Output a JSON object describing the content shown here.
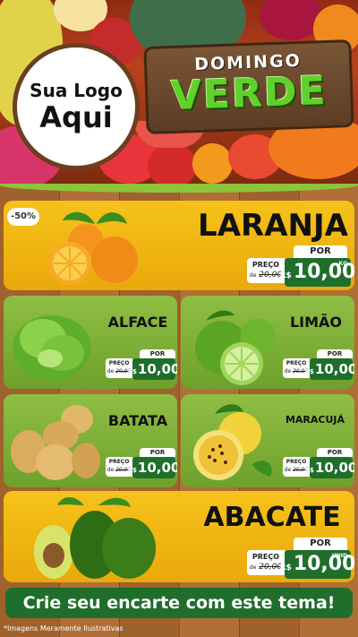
{
  "header": {
    "logo_line1": "Sua Logo",
    "logo_line2": "Aqui",
    "title_top": "DOMINGO",
    "title_bottom": "VERDE"
  },
  "colors": {
    "yellow_card": "#f6c21a",
    "green_card": "#8fbe43",
    "price_green": "#1f6e2c",
    "title_green": "#5fd12b",
    "wood": "#a0622d"
  },
  "discount_badge": "-50%",
  "products": [
    {
      "name": "LARANJA",
      "por": "POR",
      "preco_label": "PREÇO",
      "old_price": "20,00",
      "old_prefix": "de",
      "currency": "R$",
      "price": "10,00",
      "unit": "KG",
      "icon": "orange-icon"
    },
    {
      "name": "ALFACE",
      "por": "POR",
      "preco_label": "PREÇO",
      "old_price": "20,00",
      "old_prefix": "de",
      "currency": "R$",
      "price": "10,00",
      "unit": "",
      "icon": "lettuce-icon"
    },
    {
      "name": "LIMÃO",
      "por": "POR",
      "preco_label": "PREÇO",
      "old_price": "20,00",
      "old_prefix": "de",
      "currency": "R$",
      "price": "10,00",
      "unit": "",
      "icon": "lime-icon"
    },
    {
      "name": "BATATA",
      "por": "POR",
      "preco_label": "PREÇO",
      "old_price": "20,00",
      "old_prefix": "de",
      "currency": "R$",
      "price": "10,00",
      "unit": "",
      "icon": "potato-icon"
    },
    {
      "name": "MARACUJÁ",
      "por": "POR",
      "preco_label": "PREÇO",
      "old_price": "20,00",
      "old_prefix": "de",
      "currency": "R$",
      "price": "10,00",
      "unit": "",
      "icon": "passion-fruit-icon"
    },
    {
      "name": "ABACATE",
      "por": "POR",
      "preco_label": "PREÇO",
      "old_price": "20,00",
      "old_prefix": "de",
      "currency": "R$",
      "price": "10,00",
      "unit": "UNID",
      "icon": "avocado-icon"
    }
  ],
  "banner": "Crie seu encarte com este tema!",
  "footnote": "*Imagens Meramente Ilustrativas"
}
